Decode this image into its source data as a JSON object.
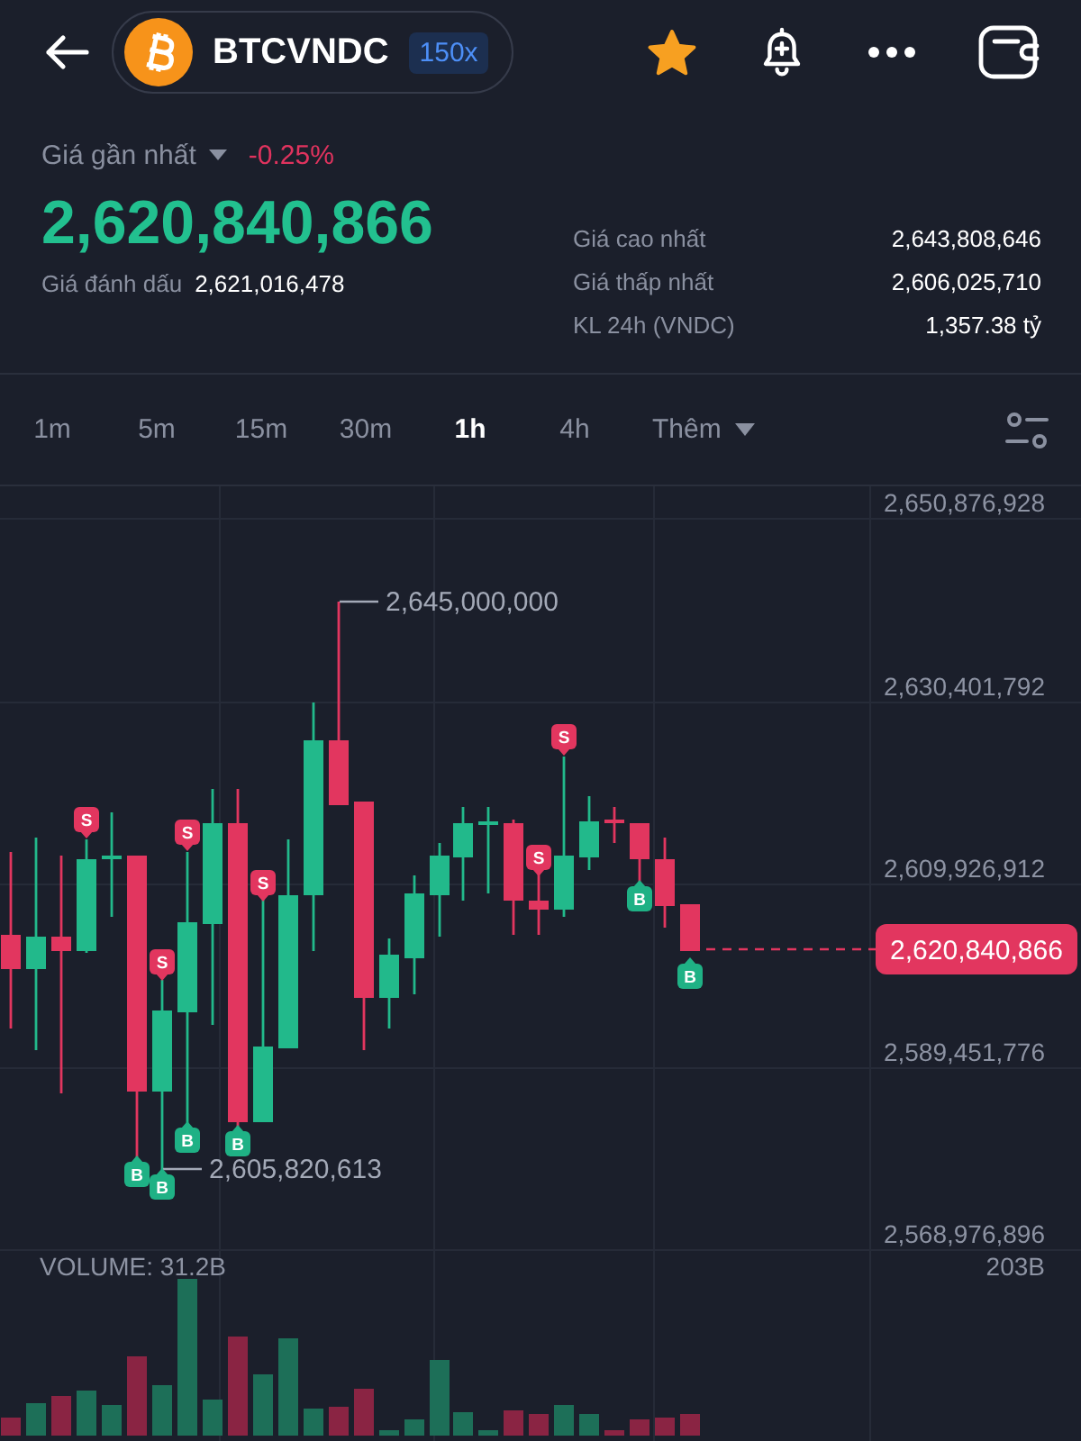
{
  "header": {
    "symbol": "BTCVNDC",
    "leverage": "150x",
    "favorite": true
  },
  "price_summary": {
    "selector": "Giá gần nhất",
    "change": "-0.25%",
    "last_price": "2,620,840,866",
    "mark_label": "Giá đánh dấu",
    "mark_price": "2,621,016,478"
  },
  "stats": [
    {
      "label": "Giá cao nhất",
      "value": "2,643,808,646"
    },
    {
      "label": "Giá thấp nhất",
      "value": "2,606,025,710"
    },
    {
      "label": "KL 24h (VNDC)",
      "value": "1,357.38 tỷ"
    }
  ],
  "timeframes": [
    {
      "label": "1m",
      "selected": false
    },
    {
      "label": "5m",
      "selected": false
    },
    {
      "label": "15m",
      "selected": false
    },
    {
      "label": "30m",
      "selected": false
    },
    {
      "label": "1h",
      "selected": true
    },
    {
      "label": "4h",
      "selected": false
    }
  ],
  "more_menu": {
    "label": "Thêm"
  },
  "chart": {
    "price_axis": [
      "2,650,876,928",
      "2,630,401,792",
      "2,609,926,912",
      "2,589,451,776",
      "2,568,976,896"
    ],
    "high_label": "2,645,000,000",
    "low_label": "2,605,820,613",
    "last_price_tag": "2,620,840,866",
    "trade_markers": [
      {
        "kind": "sell",
        "label": "S"
      },
      {
        "kind": "buy",
        "label": "B"
      },
      {
        "kind": "sell",
        "label": "S"
      },
      {
        "kind": "buy",
        "label": "B"
      },
      {
        "kind": "sell",
        "label": "S"
      },
      {
        "kind": "buy",
        "label": "B"
      },
      {
        "kind": "buy",
        "label": "B"
      },
      {
        "kind": "sell",
        "label": "S"
      },
      {
        "kind": "sell",
        "label": "S"
      },
      {
        "kind": "sell",
        "label": "S"
      },
      {
        "kind": "buy",
        "label": "B"
      },
      {
        "kind": "buy",
        "label": "B"
      }
    ],
    "volume_label": "VOLUME: 31.2B",
    "volume_axis_label": "203B"
  }
}
